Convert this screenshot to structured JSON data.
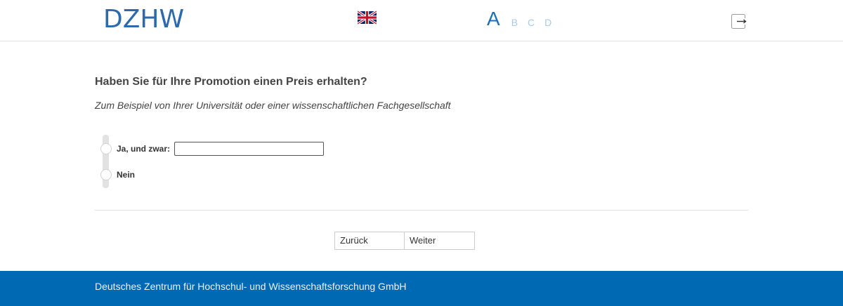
{
  "header": {
    "logo_text": "DZHW",
    "language_flag": "uk-flag-icon",
    "progress_steps": [
      {
        "label": "A",
        "active": true
      },
      {
        "label": "B",
        "active": false
      },
      {
        "label": "C",
        "active": false
      },
      {
        "label": "D",
        "active": false
      }
    ],
    "exit_icon": "exit-icon"
  },
  "question": {
    "title": "Haben Sie für Ihre Promotion einen Preis erhalten?",
    "instruction": "Zum Beispiel von Ihrer Universität oder einer wissenschaftlichen Fachgesellschaft",
    "options": [
      {
        "label": "Ja, und zwar:",
        "has_text_field": true,
        "text_value": ""
      },
      {
        "label": "Nein",
        "has_text_field": false
      }
    ]
  },
  "navigation": {
    "back_label": "Zurück",
    "next_label": "Weiter"
  },
  "footer": {
    "text": "Deutsches Zentrum für Hochschul- und Wissenschaftsforschung GmbH"
  },
  "colors": {
    "brand_blue": "#0069b4",
    "logo_blue": "#2a6aad",
    "progress_active": "#1e6fb5",
    "progress_inactive": "#a9cbe8"
  }
}
